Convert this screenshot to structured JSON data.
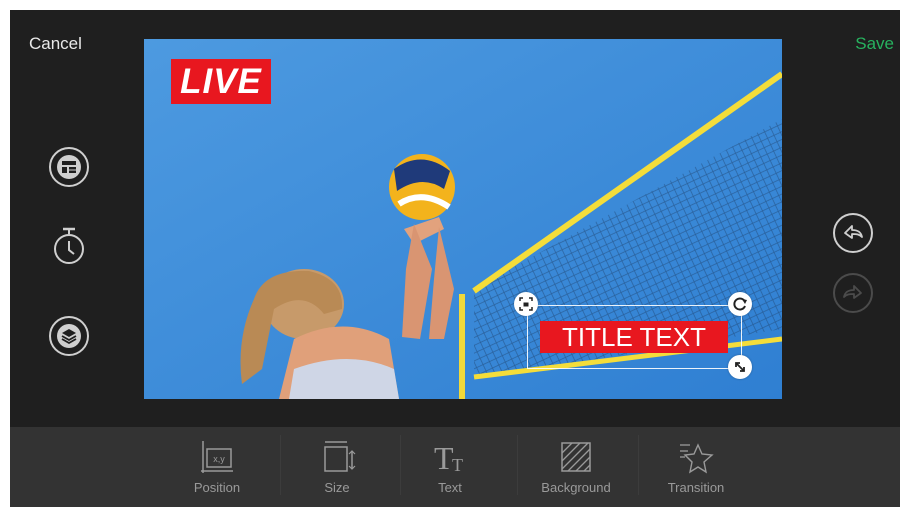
{
  "header": {
    "cancel_label": "Cancel",
    "save_label": "Save"
  },
  "side_left": [
    {
      "icon": "layout-icon"
    },
    {
      "icon": "timer-icon"
    },
    {
      "icon": "layers-icon"
    }
  ],
  "side_right": [
    {
      "icon": "undo-icon",
      "enabled": true
    },
    {
      "icon": "redo-icon",
      "enabled": false
    }
  ],
  "canvas": {
    "live_badge": "LIVE",
    "title_text": "TITLE TEXT",
    "image_description_icon": "volleyball-photo"
  },
  "toolbar": {
    "tools": [
      {
        "label": "Position",
        "icon": "position-icon",
        "icon_text": "x,y"
      },
      {
        "label": "Size",
        "icon": "size-icon"
      },
      {
        "label": "Text",
        "icon": "text-icon"
      },
      {
        "label": "Background",
        "icon": "background-icon"
      },
      {
        "label": "Transition",
        "icon": "transition-icon"
      }
    ]
  },
  "colors": {
    "accent_green": "#27b25f",
    "badge_red": "#e8171f",
    "app_bg": "#1f1f1f",
    "toolbar_bg": "#333333"
  }
}
